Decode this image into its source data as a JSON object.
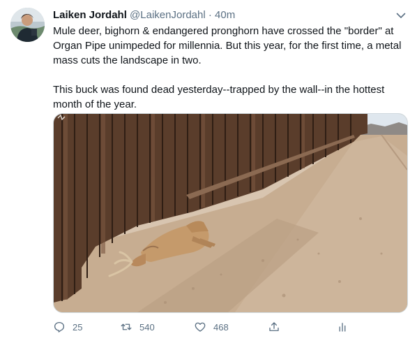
{
  "tweet": {
    "author_name": "Laiken Jordahl",
    "author_handle": "@LaikenJordahl",
    "separator": "·",
    "time": "40m",
    "paragraphs": [
      "Mule deer, bighorn & endangered pronghorn have crossed the \"border\" at Organ Pipe unimpeded for millennia. But this year, for the first time, a metal mass cuts the landscape in two.",
      "This buck was found dead yesterday--trapped by the wall--in the hottest month of the year."
    ],
    "media": {
      "description_icon": "photo"
    },
    "actions": {
      "reply_count": "25",
      "retweet_count": "540",
      "like_count": "468"
    }
  },
  "icons": {
    "caret": "chevron-down-icon",
    "reply": "reply-icon",
    "retweet": "retweet-icon",
    "like": "heart-icon",
    "share": "share-icon",
    "analytics": "analytics-icon"
  },
  "colors": {
    "text": "#0f1419",
    "secondary": "#5b7083",
    "border": "#cfd9de"
  }
}
